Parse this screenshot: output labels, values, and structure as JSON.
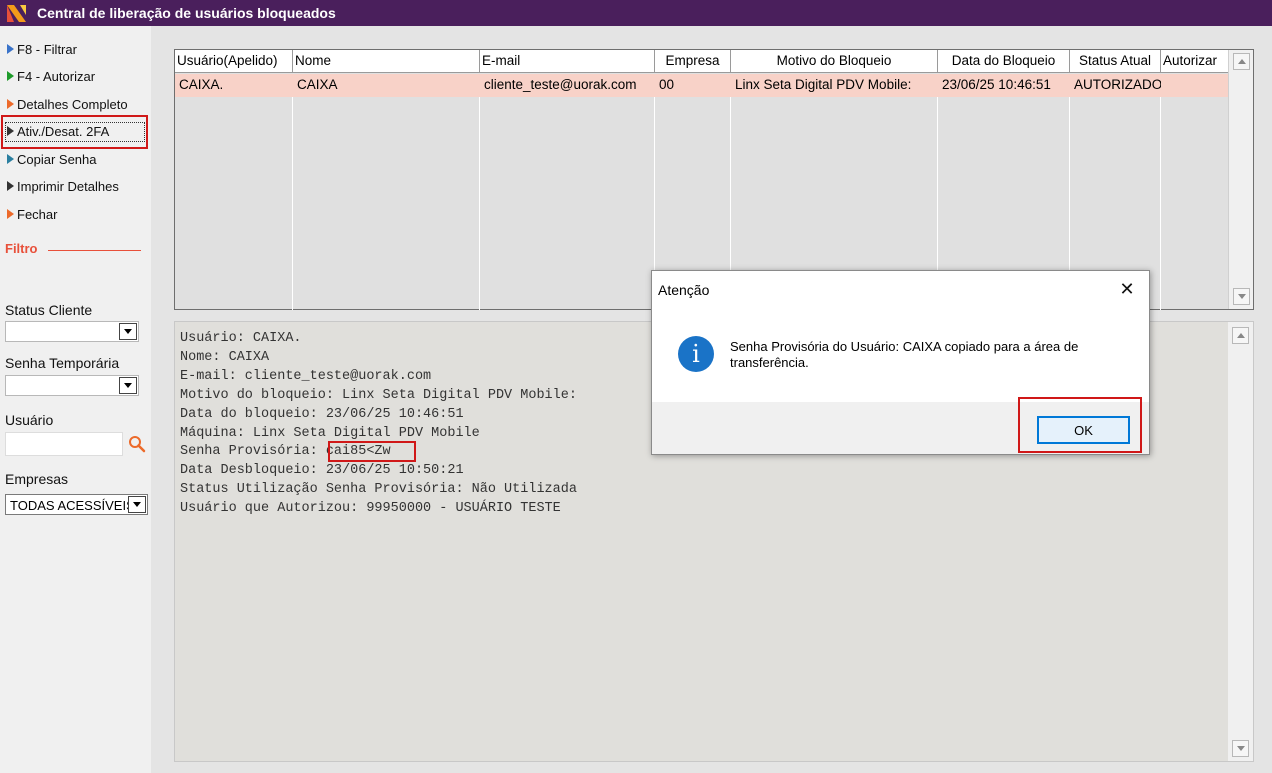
{
  "window": {
    "title": "Central de liberação de usuários bloqueados",
    "icon": "app-logo-icon"
  },
  "sidebar": {
    "items": [
      {
        "label": "F8 - Filtrar",
        "color": "#3a73c9"
      },
      {
        "label": "F4 - Autorizar",
        "color": "#1e9b2a"
      },
      {
        "label": "Detalhes Completo",
        "color": "#ec6a2a"
      },
      {
        "label": "Ativ./Desat. 2FA",
        "color": "#333333"
      },
      {
        "label": "Copiar Senha",
        "color": "#2b7fa0"
      },
      {
        "label": "Imprimir Detalhes",
        "color": "#333333"
      },
      {
        "label": "Fechar",
        "color": "#ec6a2a"
      }
    ],
    "filtro_label": "Filtro",
    "status_cliente_label": "Status Cliente",
    "status_cliente_value": "",
    "senha_temporaria_label": "Senha Temporária",
    "senha_temporaria_value": "",
    "usuario_label": "Usuário",
    "usuario_value": "",
    "empresas_label": "Empresas",
    "empresas_value": "TODAS ACESSÍVEIS"
  },
  "grid": {
    "columns": [
      "Usuário(Apelido)",
      "Nome",
      "E-mail",
      "Empresa",
      "Motivo do Bloqueio",
      "Data do Bloqueio",
      "Status Atual",
      "Autorizar"
    ],
    "rows": [
      [
        "CAIXA.",
        "CAIXA",
        "cliente_teste@uorak.com",
        "00",
        "Linx Seta Digital PDV Mobile:",
        "23/06/25 10:46:51",
        "AUTORIZADO",
        ""
      ]
    ]
  },
  "details": {
    "lines": [
      "Usuário: CAIXA.",
      "Nome: CAIXA",
      "E-mail: cliente_teste@uorak.com",
      "Motivo do bloqueio: Linx Seta Digital PDV Mobile:",
      "Data do bloqueio: 23/06/25 10:46:51",
      "Máquina: Linx Seta Digital PDV Mobile",
      "Senha Provisória: cai85<Zw",
      "Data Desbloqueio: 23/06/25 10:50:21",
      "Status Utilização Senha Provisória: Não Utilizada",
      "Usuário que Autorizou: 99950000 - USUÁRIO TESTE"
    ]
  },
  "dialog": {
    "title": "Atenção",
    "close": "✕",
    "message": "Senha Provisória do Usuário: CAIXA copiado para a área de transferência.",
    "ok_label": "OK",
    "icon": "info-icon"
  }
}
